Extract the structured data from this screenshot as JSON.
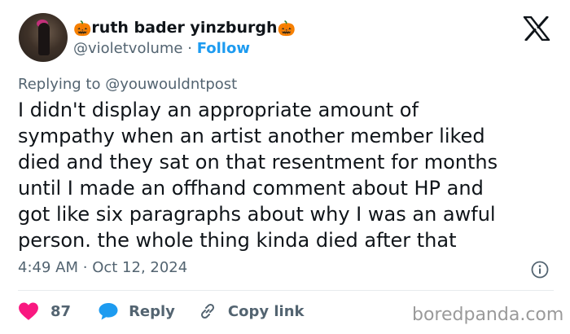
{
  "author": {
    "display_name_prefix": "🎃",
    "display_name": "ruth bader yinzburgh",
    "display_name_suffix": "🎃",
    "handle": "@violetvolume",
    "separator": "·",
    "follow_label": "Follow"
  },
  "reply": {
    "prefix": "Replying to",
    "target": "@youwouldntpost"
  },
  "tweet": {
    "text": "I didn't display an appropriate amount of\nsympathy when an artist another member liked\ndied and they sat on that resentment for months\nuntil I made an offhand comment about HP and\ngot like six paragraphs about why I was an awful\nperson. the whole thing kinda died after that",
    "time": "4:49 AM",
    "separator": "·",
    "date": "Oct 12, 2024"
  },
  "actions": {
    "like_count": "87",
    "reply_label": "Reply",
    "copy_link_label": "Copy link"
  },
  "watermark": "boredpanda.com",
  "colors": {
    "accent": "#1d9bf0",
    "like": "#f91880",
    "muted": "#536471",
    "text": "#0f1419"
  },
  "icons": {
    "brand": "x-logo-icon",
    "info": "info-icon",
    "like": "heart-icon",
    "reply": "speech-bubble-icon",
    "copy": "link-icon"
  }
}
